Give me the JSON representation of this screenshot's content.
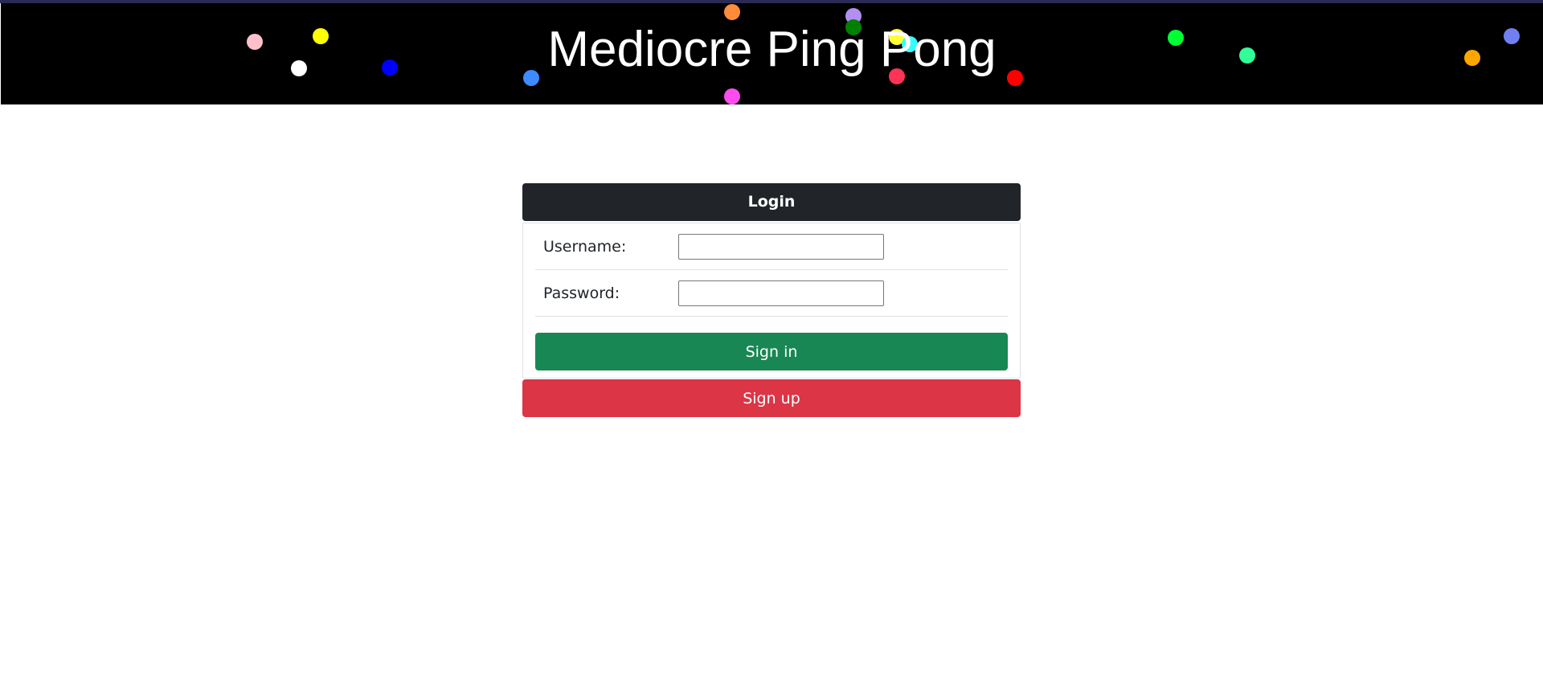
{
  "banner": {
    "title": "Mediocre Ping Pong",
    "balls": [
      {
        "name": "ball-pink",
        "color": "#ffc0cb"
      },
      {
        "name": "ball-yellow",
        "color": "#ffff00"
      },
      {
        "name": "ball-white",
        "color": "#ffffff"
      },
      {
        "name": "ball-blue",
        "color": "#0000ff"
      },
      {
        "name": "ball-dodgerblue",
        "color": "#3d8bff"
      },
      {
        "name": "ball-orange",
        "color": "#ff8c3a"
      },
      {
        "name": "ball-magenta",
        "color": "#ff4cf0"
      },
      {
        "name": "ball-lavender",
        "color": "#b28ff0"
      },
      {
        "name": "ball-green",
        "color": "#008000"
      },
      {
        "name": "ball-yellow-2",
        "color": "#ffff33"
      },
      {
        "name": "ball-cyan",
        "color": "#33ffff"
      },
      {
        "name": "ball-crimson",
        "color": "#ff3355"
      },
      {
        "name": "ball-red",
        "color": "#ff0000"
      },
      {
        "name": "ball-lime",
        "color": "#00ff33"
      },
      {
        "name": "ball-seagreen",
        "color": "#33ff99"
      },
      {
        "name": "ball-darkorange",
        "color": "#ffa500"
      },
      {
        "name": "ball-slateblue",
        "color": "#7080f0"
      }
    ]
  },
  "login": {
    "header": "Login",
    "username_label": "Username:",
    "username_value": "",
    "password_label": "Password:",
    "password_value": "",
    "signin_label": "Sign in",
    "signup_label": "Sign up"
  },
  "colors": {
    "header_bg": "#212529",
    "signin_bg": "#198754",
    "signup_bg": "#dc3545"
  }
}
